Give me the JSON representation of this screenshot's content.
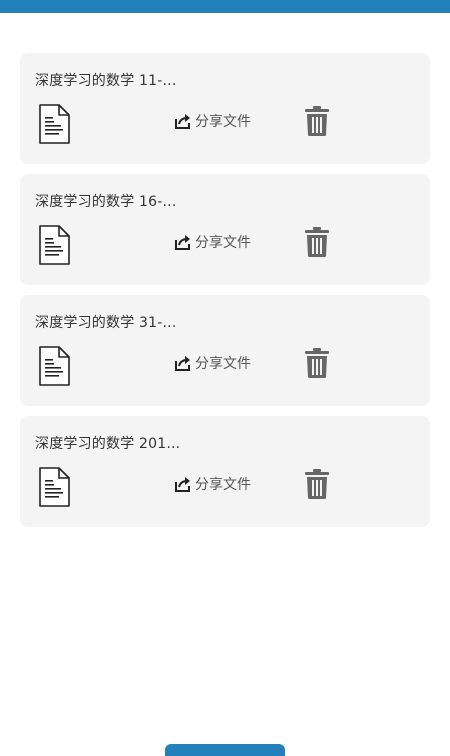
{
  "colors": {
    "accent": "#2280bb",
    "card_background": "#f4f4f4",
    "icon": "#666666"
  },
  "files": [
    {
      "name": "深度学习的数学 11-...",
      "share_label": "分享文件",
      "file_icon": "document-icon",
      "share_icon": "share-icon",
      "delete_icon": "trash-icon"
    },
    {
      "name": "深度学习的数学 16-...",
      "share_label": "分享文件",
      "file_icon": "document-icon",
      "share_icon": "share-icon",
      "delete_icon": "trash-icon"
    },
    {
      "name": "深度学习的数学 31-...",
      "share_label": "分享文件",
      "file_icon": "document-icon",
      "share_icon": "share-icon",
      "delete_icon": "trash-icon"
    },
    {
      "name": "深度学习的数学 201...",
      "share_label": "分享文件",
      "file_icon": "document-icon",
      "share_icon": "share-icon",
      "delete_icon": "trash-icon"
    }
  ]
}
